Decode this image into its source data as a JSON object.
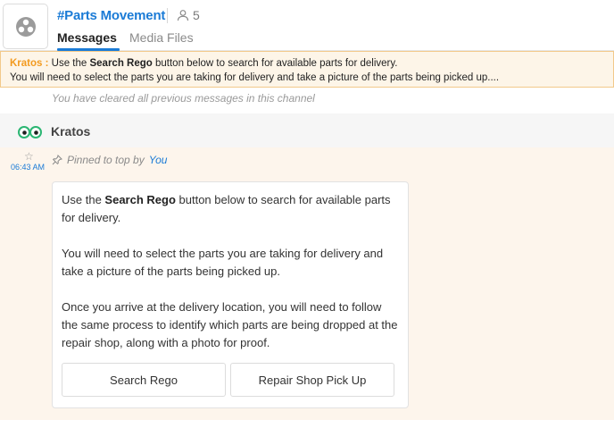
{
  "channel": {
    "title": "#Parts Movement",
    "member_count": "5",
    "icon": "users-icon"
  },
  "tabs": [
    {
      "label": "Messages",
      "active": true
    },
    {
      "label": "Media Files",
      "active": false
    }
  ],
  "pinned_banner": {
    "author": "Kratos :",
    "line1_before": "Use the ",
    "line1_bold": "Search Rego",
    "line1_after": " button below to search for available parts for delivery.",
    "line2": "You will need to select the parts you are taking for delivery and take a picture of the parts being picked up...."
  },
  "cleared_notice": "You have cleared all previous messages in this channel",
  "message": {
    "sender": "Kratos",
    "time": "06:43 AM",
    "pinned_prefix": "Pinned to top by",
    "pinned_by": "You",
    "para1_before": "Use the ",
    "para1_bold": "Search Rego",
    "para1_after": " button below to search for available parts for delivery.",
    "para2": "You will need to select the parts you are taking for delivery and take a picture of the parts being picked up.",
    "para3": "Once you arrive at the delivery location, you will need to follow the same process to identify which parts are being dropped at the repair shop, along with a photo for proof.",
    "buttons": {
      "search": "Search Rego",
      "repair": "Repair Shop Pick Up"
    }
  },
  "colors": {
    "accent": "#1b7bd6",
    "banner_bg": "#fdf5e8",
    "banner_border": "#f2c98a",
    "author": "#f29a1f"
  }
}
